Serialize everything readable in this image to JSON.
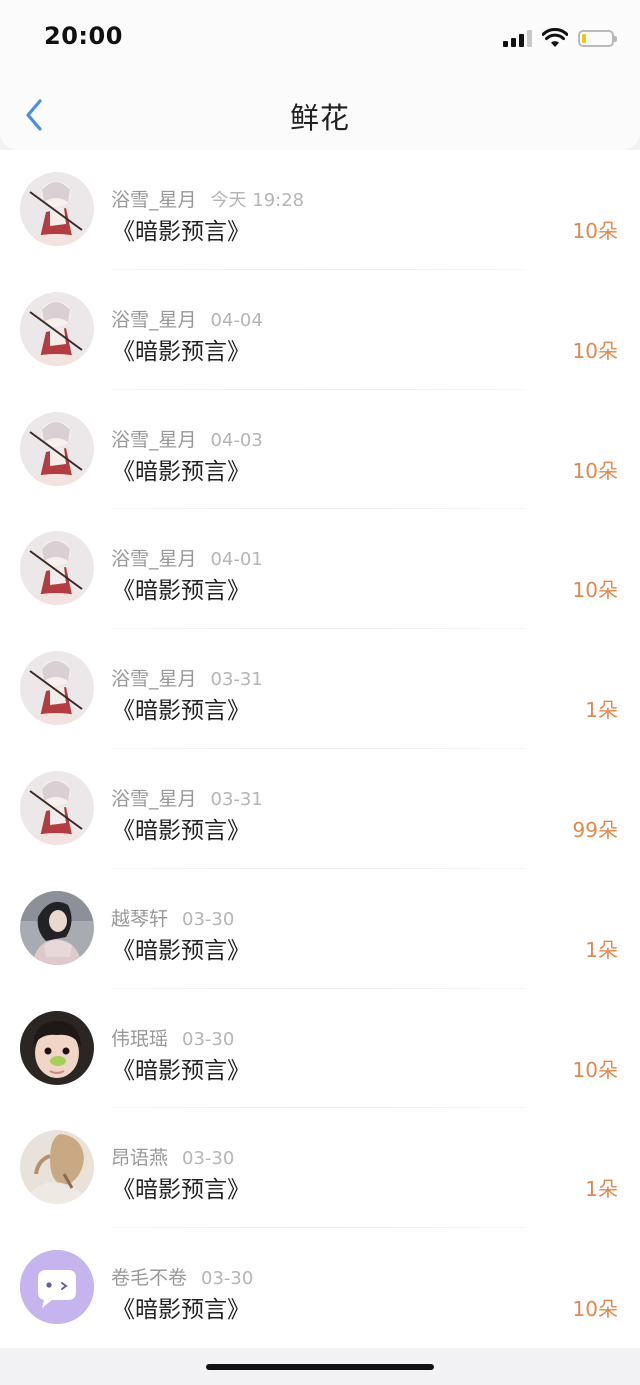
{
  "status_bar": {
    "time": "20:00"
  },
  "header": {
    "title": "鲜花"
  },
  "items": [
    {
      "user": "浴雪_星月",
      "time": "今天 19:28",
      "book": "《暗影预言》",
      "count": "10朵",
      "avatar": "anime-girl-avatar"
    },
    {
      "user": "浴雪_星月",
      "time": "04-04",
      "book": "《暗影预言》",
      "count": "10朵",
      "avatar": "anime-girl-avatar"
    },
    {
      "user": "浴雪_星月",
      "time": "04-03",
      "book": "《暗影预言》",
      "count": "10朵",
      "avatar": "anime-girl-avatar"
    },
    {
      "user": "浴雪_星月",
      "time": "04-01",
      "book": "《暗影预言》",
      "count": "10朵",
      "avatar": "anime-girl-avatar"
    },
    {
      "user": "浴雪_星月",
      "time": "03-31",
      "book": "《暗影预言》",
      "count": "1朵",
      "avatar": "anime-girl-avatar"
    },
    {
      "user": "浴雪_星月",
      "time": "03-31",
      "book": "《暗影预言》",
      "count": "99朵",
      "avatar": "anime-girl-avatar"
    },
    {
      "user": "越琴轩",
      "time": "03-30",
      "book": "《暗影预言》",
      "count": "1朵",
      "avatar": "woman-photo-avatar"
    },
    {
      "user": "伟珉瑶",
      "time": "03-30",
      "book": "《暗影预言》",
      "count": "10朵",
      "avatar": "child-photo-avatar"
    },
    {
      "user": "昂语燕",
      "time": "03-30",
      "book": "《暗影预言》",
      "count": "1朵",
      "avatar": "woman-back-photo-avatar"
    },
    {
      "user": "卷毛不卷",
      "time": "03-30",
      "book": "《暗影预言》",
      "count": "10朵",
      "avatar": "default-chat-avatar"
    }
  ],
  "colors": {
    "accent_back": "#4a90e2",
    "count": "#e0894f",
    "battery_fill": "#f0c419",
    "default_avatar_bg": "#c5b4ee"
  }
}
